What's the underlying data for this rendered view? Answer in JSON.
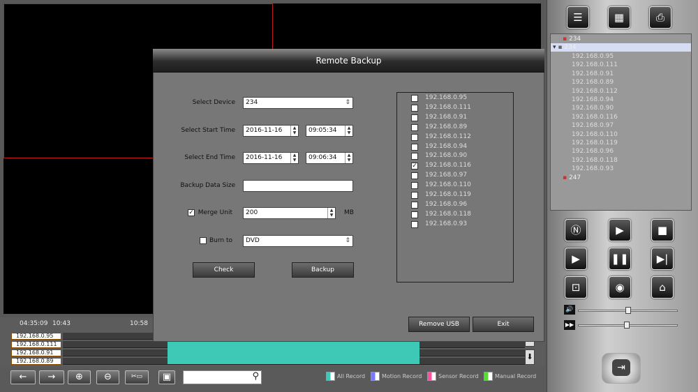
{
  "timeline": {
    "start_time": "04:35:09",
    "cursor_time": "10:43",
    "end_time": "10:58",
    "rows": [
      "192.168.0.95",
      "192.168.0.111",
      "192.168.0.91",
      "192.168.0.89"
    ]
  },
  "toolbar": {
    "search_placeholder": ""
  },
  "legend": [
    {
      "label": "All Record",
      "color": "#3ec9b6"
    },
    {
      "label": "Motion Record",
      "color": "#7a7aff"
    },
    {
      "label": "Sensor Record",
      "color": "#ff4fa0"
    },
    {
      "label": "Manual Record",
      "color": "#55dd33"
    }
  ],
  "device_tree": {
    "groups": [
      {
        "name": "234",
        "selected": false
      },
      {
        "name": "234",
        "selected": true
      },
      {
        "name": "247",
        "selected": false
      }
    ],
    "children": [
      "192.168.0.95",
      "192.168.0.111",
      "192.168.0.91",
      "192.168.0.89",
      "192.168.0.112",
      "192.168.0.94",
      "192.168.0.90",
      "192.168.0.116",
      "192.168.0.97",
      "192.168.0.110",
      "192.168.0.119",
      "192.168.0.96",
      "192.168.0.118",
      "192.168.0.93"
    ]
  },
  "dialog": {
    "title": "Remote Backup",
    "select_device_label": "Select Device",
    "select_device_value": "234",
    "start_time_label": "Select Start Time",
    "start_date": "2016-11-16",
    "start_time": "09:05:34",
    "end_time_label": "Select End Time",
    "end_date": "2016-11-16",
    "end_time": "09:06:34",
    "data_size_label": "Backup Data Size",
    "data_size_value": "",
    "merge_unit_label": "Merge Unit",
    "merge_unit_checked": true,
    "merge_unit_value": "200",
    "merge_unit_unit": "MB",
    "burn_to_label": "Burn to",
    "burn_to_checked": false,
    "burn_to_value": "DVD",
    "check_button": "Check",
    "backup_button": "Backup",
    "remove_usb_button": "Remove USB",
    "exit_button": "Exit",
    "devices": [
      {
        "ip": "192.168.0.95",
        "checked": false
      },
      {
        "ip": "192.168.0.111",
        "checked": false
      },
      {
        "ip": "192.168.0.91",
        "checked": false
      },
      {
        "ip": "192.168.0.89",
        "checked": false
      },
      {
        "ip": "192.168.0.112",
        "checked": false
      },
      {
        "ip": "192.168.0.94",
        "checked": false
      },
      {
        "ip": "192.168.0.90",
        "checked": false
      },
      {
        "ip": "192.168.0.116",
        "checked": true
      },
      {
        "ip": "192.168.0.97",
        "checked": false
      },
      {
        "ip": "192.168.0.110",
        "checked": false
      },
      {
        "ip": "192.168.0.119",
        "checked": false
      },
      {
        "ip": "192.168.0.96",
        "checked": false
      },
      {
        "ip": "192.168.0.118",
        "checked": false
      },
      {
        "ip": "192.168.0.93",
        "checked": false
      }
    ]
  }
}
